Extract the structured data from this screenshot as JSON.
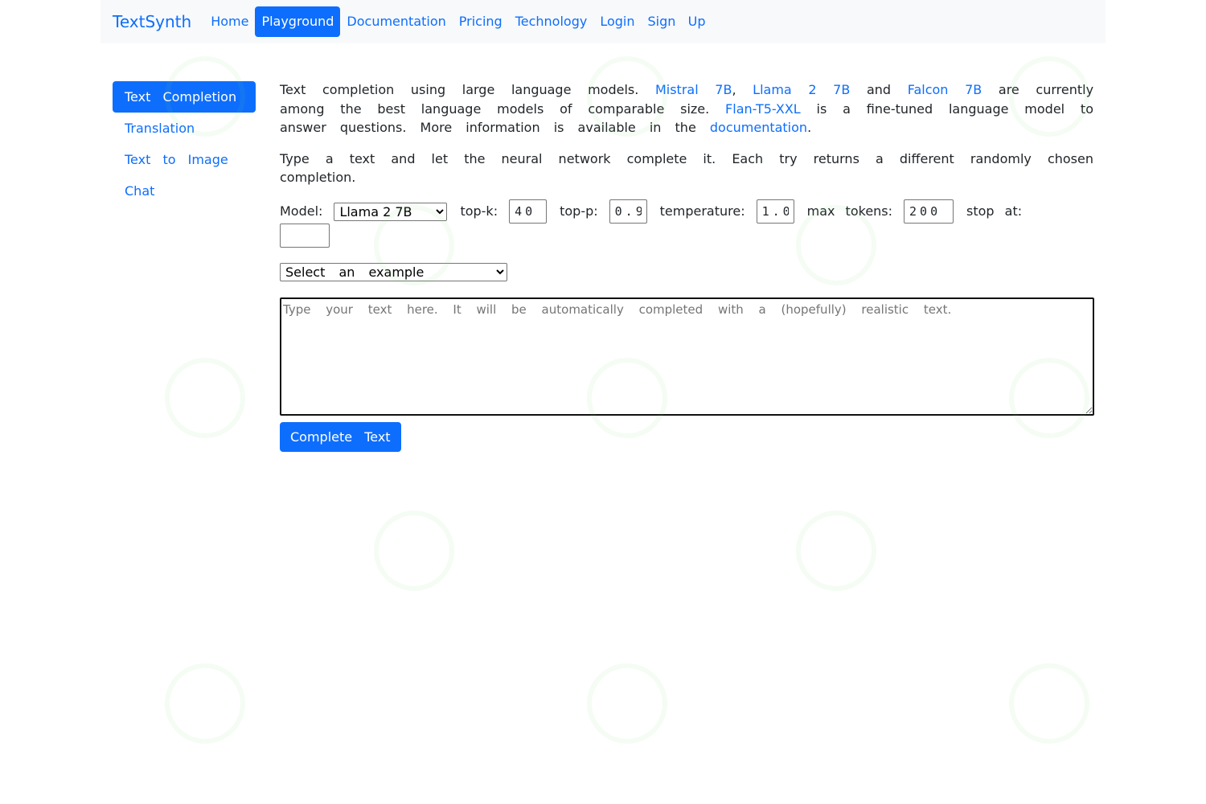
{
  "navbar": {
    "brand": "TextSynth",
    "links": [
      {
        "label": "Home",
        "active": false
      },
      {
        "label": "Playground",
        "active": true
      },
      {
        "label": "Documentation",
        "active": false
      },
      {
        "label": "Pricing",
        "active": false
      },
      {
        "label": "Technology",
        "active": false
      },
      {
        "label": "Login",
        "active": false
      },
      {
        "label": "Sign   Up",
        "active": false
      }
    ]
  },
  "sidebar": {
    "items": [
      {
        "label": "Text Completion",
        "active": true
      },
      {
        "label": "Translation",
        "active": false
      },
      {
        "label": "Text to Image",
        "active": false
      },
      {
        "label": "Chat",
        "active": false
      }
    ]
  },
  "intro": {
    "t1": "Text completion using large language models. ",
    "link_mistral": "Mistral 7B",
    "t2": ", ",
    "link_llama": "Llama 2 7B",
    "t3": " and ",
    "link_falcon": "Falcon 7B",
    "t4": " are currently among the best language models of comparable size. ",
    "link_flan": "Flan-T5-XXL",
    "t5": " is a fine-tuned language model to answer questions. More information is available in the ",
    "link_doc": "documentation",
    "t6": "."
  },
  "instructions": "Type a text and let the neural network complete it. Each try returns a different randomly chosen completion.",
  "controls": {
    "model_label": "Model:",
    "model_value": "Llama 2  7B",
    "topk_label": "top-k:",
    "topk_value": "40",
    "topp_label": "top-p:",
    "topp_value": "0.9",
    "temperature_label": "temperature:",
    "temperature_value": "1.0",
    "max_tokens_label": "max tokens:",
    "max_tokens_value": "200",
    "stop_label": "stop at:",
    "stop_value": ""
  },
  "example_select": {
    "selected": "Select an example"
  },
  "prompt": {
    "placeholder": "Type your text here. It will be automatically completed with a (hopefully) realistic text.",
    "value": ""
  },
  "complete_button": "Complete Text",
  "colors": {
    "accent": "#0d6efd",
    "navbar_bg": "#f8f9fa"
  }
}
